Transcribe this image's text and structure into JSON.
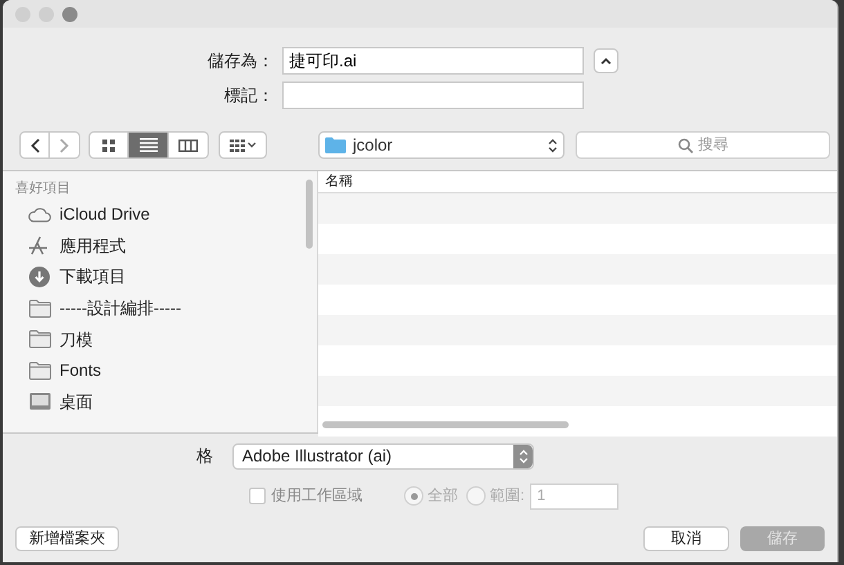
{
  "save_as": {
    "label": "儲存為：",
    "value": "捷可印.ai"
  },
  "tags": {
    "label": "標記："
  },
  "toolbar": {
    "views": [
      {
        "kind": "icons",
        "selected": false
      },
      {
        "kind": "list",
        "selected": true
      },
      {
        "kind": "columns",
        "selected": false
      }
    ],
    "location": "jcolor",
    "search": {
      "placeholder": "搜尋"
    }
  },
  "sidebar": {
    "heading": "喜好項目",
    "items": [
      {
        "kind": "cloud",
        "label": "iCloud Drive"
      },
      {
        "kind": "apps",
        "label": "應用程式"
      },
      {
        "kind": "download",
        "label": "下載項目"
      },
      {
        "kind": "folder",
        "label": "-----設計編排-----"
      },
      {
        "kind": "folder",
        "label": "刀模"
      },
      {
        "kind": "folder",
        "label": "Fonts"
      },
      {
        "kind": "desktop",
        "label": "桌面"
      }
    ]
  },
  "file_list": {
    "columns": [
      "名稱"
    ]
  },
  "format": {
    "label": "格",
    "value": "Adobe Illustrator (ai)"
  },
  "options": {
    "use_artboards": {
      "label": "使用工作區域",
      "checked": false,
      "disabled": true
    },
    "range": [
      {
        "label": "全部",
        "selected": true,
        "disabled": true
      },
      {
        "label": "範圍:",
        "selected": false,
        "disabled": true
      }
    ],
    "range_value": "1"
  },
  "buttons": {
    "new_folder": "新增檔案夾",
    "cancel": "取消",
    "save": {
      "label": "儲存",
      "disabled": true
    }
  }
}
